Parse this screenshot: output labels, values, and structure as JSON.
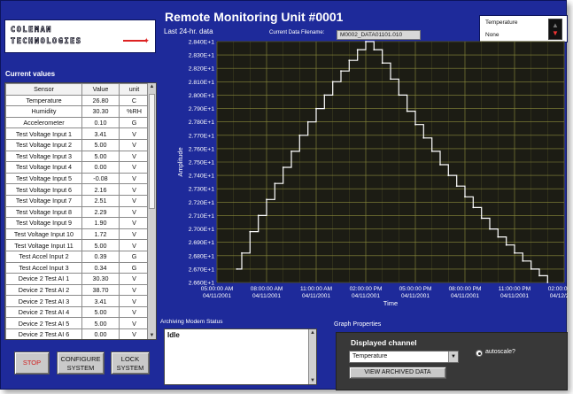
{
  "logo": {
    "line1": "COLEMAN",
    "line2": "TECHNOLOGIES",
    "mark": "✦"
  },
  "header": {
    "title": "Remote Monitoring Unit #0001",
    "subtitle": "Last 24-hr. data",
    "filename_label": "Current Data Filename:",
    "filename_value": "M0002_DATA01101.010"
  },
  "indicator": {
    "label": "Temperature",
    "value": "None",
    "up_icon": "▲",
    "down_icon": "▼"
  },
  "current_values": {
    "label": "Current values",
    "columns": [
      "Sensor",
      "Value",
      "unit"
    ],
    "rows": [
      [
        "Temperature",
        "26.80",
        "C"
      ],
      [
        "Humidity",
        "30.30",
        "%RH"
      ],
      [
        "Accelerometer",
        "0.10",
        "G"
      ],
      [
        "Test Voltage Input 1",
        "3.41",
        "V"
      ],
      [
        "Test Voltage Input 2",
        "5.00",
        "V"
      ],
      [
        "Test Voltage Input 3",
        "5.00",
        "V"
      ],
      [
        "Test Voltage Input 4",
        "0.00",
        "V"
      ],
      [
        "Test Voltage Input 5",
        "-0.08",
        "V"
      ],
      [
        "Test Voltage Input 6",
        "2.16",
        "V"
      ],
      [
        "Test Voltage Input 7",
        "2.51",
        "V"
      ],
      [
        "Test Voltage Input 8",
        "2.29",
        "V"
      ],
      [
        "Test Voltage Input 9",
        "1.90",
        "V"
      ],
      [
        "Test Voltage Input 10",
        "1.72",
        "V"
      ],
      [
        "Test Voltage Input 11",
        "5.00",
        "V"
      ],
      [
        "Test Accel Input 2",
        "0.39",
        "G"
      ],
      [
        "Test Accel Input 3",
        "0.34",
        "G"
      ],
      [
        "Device 2 Test AI 1",
        "30.30",
        "V"
      ],
      [
        "Device 2 Test AI 2",
        "38.70",
        "V"
      ],
      [
        "Device 2 Test AI 3",
        "3.41",
        "V"
      ],
      [
        "Device 2 Test AI 4",
        "5.00",
        "V"
      ],
      [
        "Device 2 Test AI 5",
        "5.00",
        "V"
      ],
      [
        "Device 2 Test AI 6",
        "0.00",
        "V"
      ]
    ]
  },
  "buttons": {
    "stop": "STOP",
    "configure_line1": "CONFIGURE",
    "configure_line2": "SYSTEM",
    "lock_line1": "LOCK",
    "lock_line2": "SYSTEM"
  },
  "archiving": {
    "label": "Archiving Modem Status",
    "status": "Idle"
  },
  "graph_properties": {
    "label": "Graph Properties",
    "channel_label": "Displayed channel",
    "channel_value": "Temperature",
    "autoscale_label": "autoscale?",
    "view_button": "VIEW ARCHIVED DATA"
  },
  "icons": {
    "scroll_up": "▲",
    "scroll_down": "▼",
    "dropdown": "▼"
  },
  "colors": {
    "panel": "#1e2a9a",
    "plot_bg": "#1c1c14",
    "grid": "#8c8c3c",
    "trace": "#ffffff"
  },
  "chart_data": {
    "type": "line",
    "xlabel": "Time",
    "ylabel": "Amplitude",
    "grid": true,
    "ylim": [
      26.6,
      28.4
    ],
    "y_ticks": [
      "2.660E+1",
      "2.670E+1",
      "2.680E+1",
      "2.690E+1",
      "2.700E+1",
      "2.710E+1",
      "2.720E+1",
      "2.730E+1",
      "2.740E+1",
      "2.750E+1",
      "2.760E+1",
      "2.770E+1",
      "2.780E+1",
      "2.790E+1",
      "2.800E+1",
      "2.810E+1",
      "2.820E+1",
      "2.830E+1",
      "2.840E+1"
    ],
    "x_ticks": [
      [
        "05:00:00 AM",
        "04/11/2001"
      ],
      [
        "08:00:00 AM",
        "04/11/2001"
      ],
      [
        "11:00:00 AM",
        "04/11/2001"
      ],
      [
        "02:00:00 PM",
        "04/11/2001"
      ],
      [
        "05:00:00 PM",
        "04/11/2001"
      ],
      [
        "08:00:00 PM",
        "04/11/2001"
      ],
      [
        "11:00:00 PM",
        "04/11/2001"
      ],
      [
        "02:00:00 AM",
        "04/12/2001"
      ]
    ],
    "series": [
      {
        "x_hours": [
          1.2,
          1.5,
          2.0,
          2.5,
          3.0,
          3.5,
          4.0,
          4.5,
          5.0,
          5.5,
          6.0,
          6.5,
          7.0,
          7.5,
          8.0,
          8.5,
          9.0,
          9.5,
          10.0,
          10.5,
          11.0,
          11.5,
          12.0,
          12.5,
          13.0,
          13.5,
          14.0,
          14.5,
          15.0,
          15.5,
          16.0,
          16.5,
          17.0,
          17.5,
          18.0,
          18.5,
          19.0,
          19.5,
          20.0
        ],
        "values": [
          26.7,
          26.82,
          26.98,
          27.1,
          27.22,
          27.34,
          27.46,
          27.58,
          27.7,
          27.8,
          27.9,
          28.0,
          28.1,
          28.18,
          28.26,
          28.34,
          28.4,
          28.34,
          28.24,
          28.12,
          28.0,
          27.88,
          27.78,
          27.68,
          27.58,
          27.48,
          27.4,
          27.32,
          27.24,
          27.16,
          27.08,
          27.0,
          26.94,
          26.88,
          26.82,
          26.76,
          26.7,
          26.65,
          26.6
        ]
      }
    ]
  }
}
